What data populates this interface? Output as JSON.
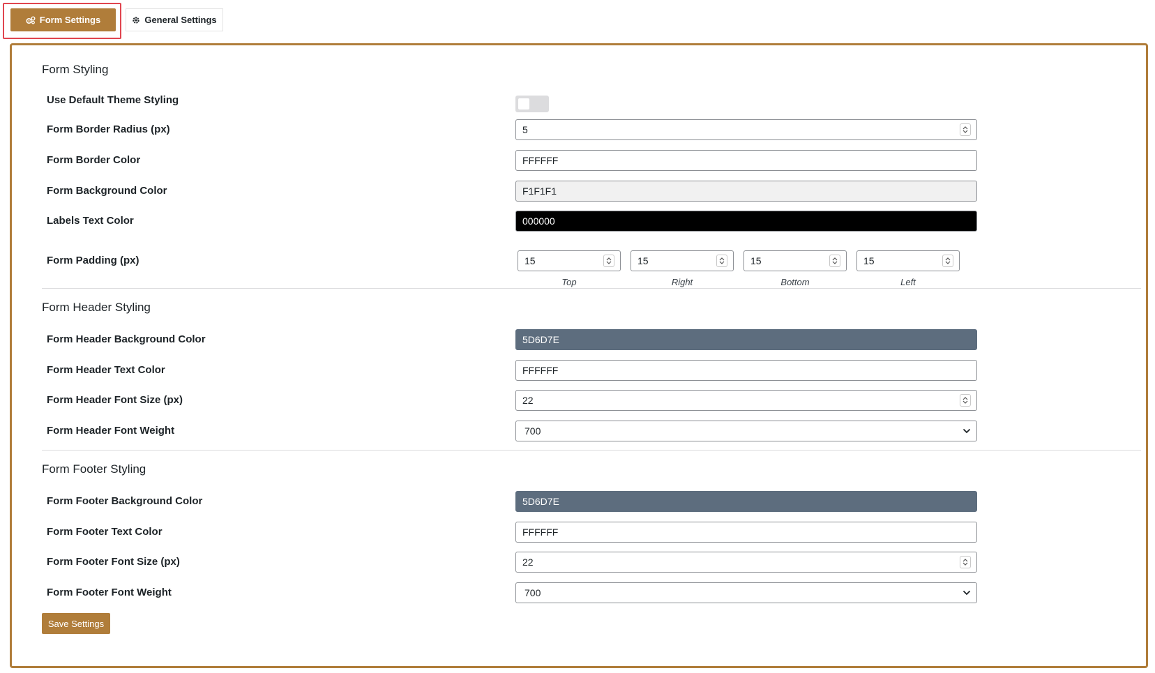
{
  "tabs": {
    "form_settings": "Form Settings",
    "general_settings": "General Settings"
  },
  "sections": {
    "form_styling": {
      "title": "Form Styling",
      "use_default_label": "Use Default Theme Styling",
      "use_default_enabled": false,
      "border_radius_label": "Form Border Radius (px)",
      "border_radius_value": "5",
      "border_color_label": "Form Border Color",
      "border_color_value": "FFFFFF",
      "background_color_label": "Form Background Color",
      "background_color_value": "F1F1F1",
      "labels_text_color_label": "Labels Text Color",
      "labels_text_color_value": "000000",
      "padding_label": "Form Padding (px)",
      "padding": {
        "top": "15",
        "right": "15",
        "bottom": "15",
        "left": "15",
        "top_caption": "Top",
        "right_caption": "Right",
        "bottom_caption": "Bottom",
        "left_caption": "Left"
      }
    },
    "header_styling": {
      "title": "Form Header Styling",
      "bg_color_label": "Form Header Background Color",
      "bg_color_value": "5D6D7E",
      "text_color_label": "Form Header Text Color",
      "text_color_value": "FFFFFF",
      "font_size_label": "Form Header Font Size (px)",
      "font_size_value": "22",
      "font_weight_label": "Form Header Font Weight",
      "font_weight_value": "700"
    },
    "footer_styling": {
      "title": "Form Footer Styling",
      "bg_color_label": "Form Footer Background Color",
      "bg_color_value": "5D6D7E",
      "text_color_label": "Form Footer Text Color",
      "text_color_value": "FFFFFF",
      "font_size_label": "Form Footer Font Size (px)",
      "font_size_value": "22",
      "font_weight_label": "Form Footer Font Weight",
      "font_weight_value": "700"
    }
  },
  "save_button": "Save Settings",
  "colors": {
    "accent": "#b07d3a",
    "highlight": "#e0454f",
    "swatch_white": "#FFFFFF",
    "swatch_light": "#F1F1F1",
    "swatch_black": "#000000",
    "swatch_slate": "#5D6D7E"
  },
  "icons": {
    "form_settings_tab": "gears-icon",
    "general_settings_tab": "gear-icon",
    "number_spinner": "spinner-arrows-icon",
    "select_dropdown": "chevron-down-icon"
  }
}
